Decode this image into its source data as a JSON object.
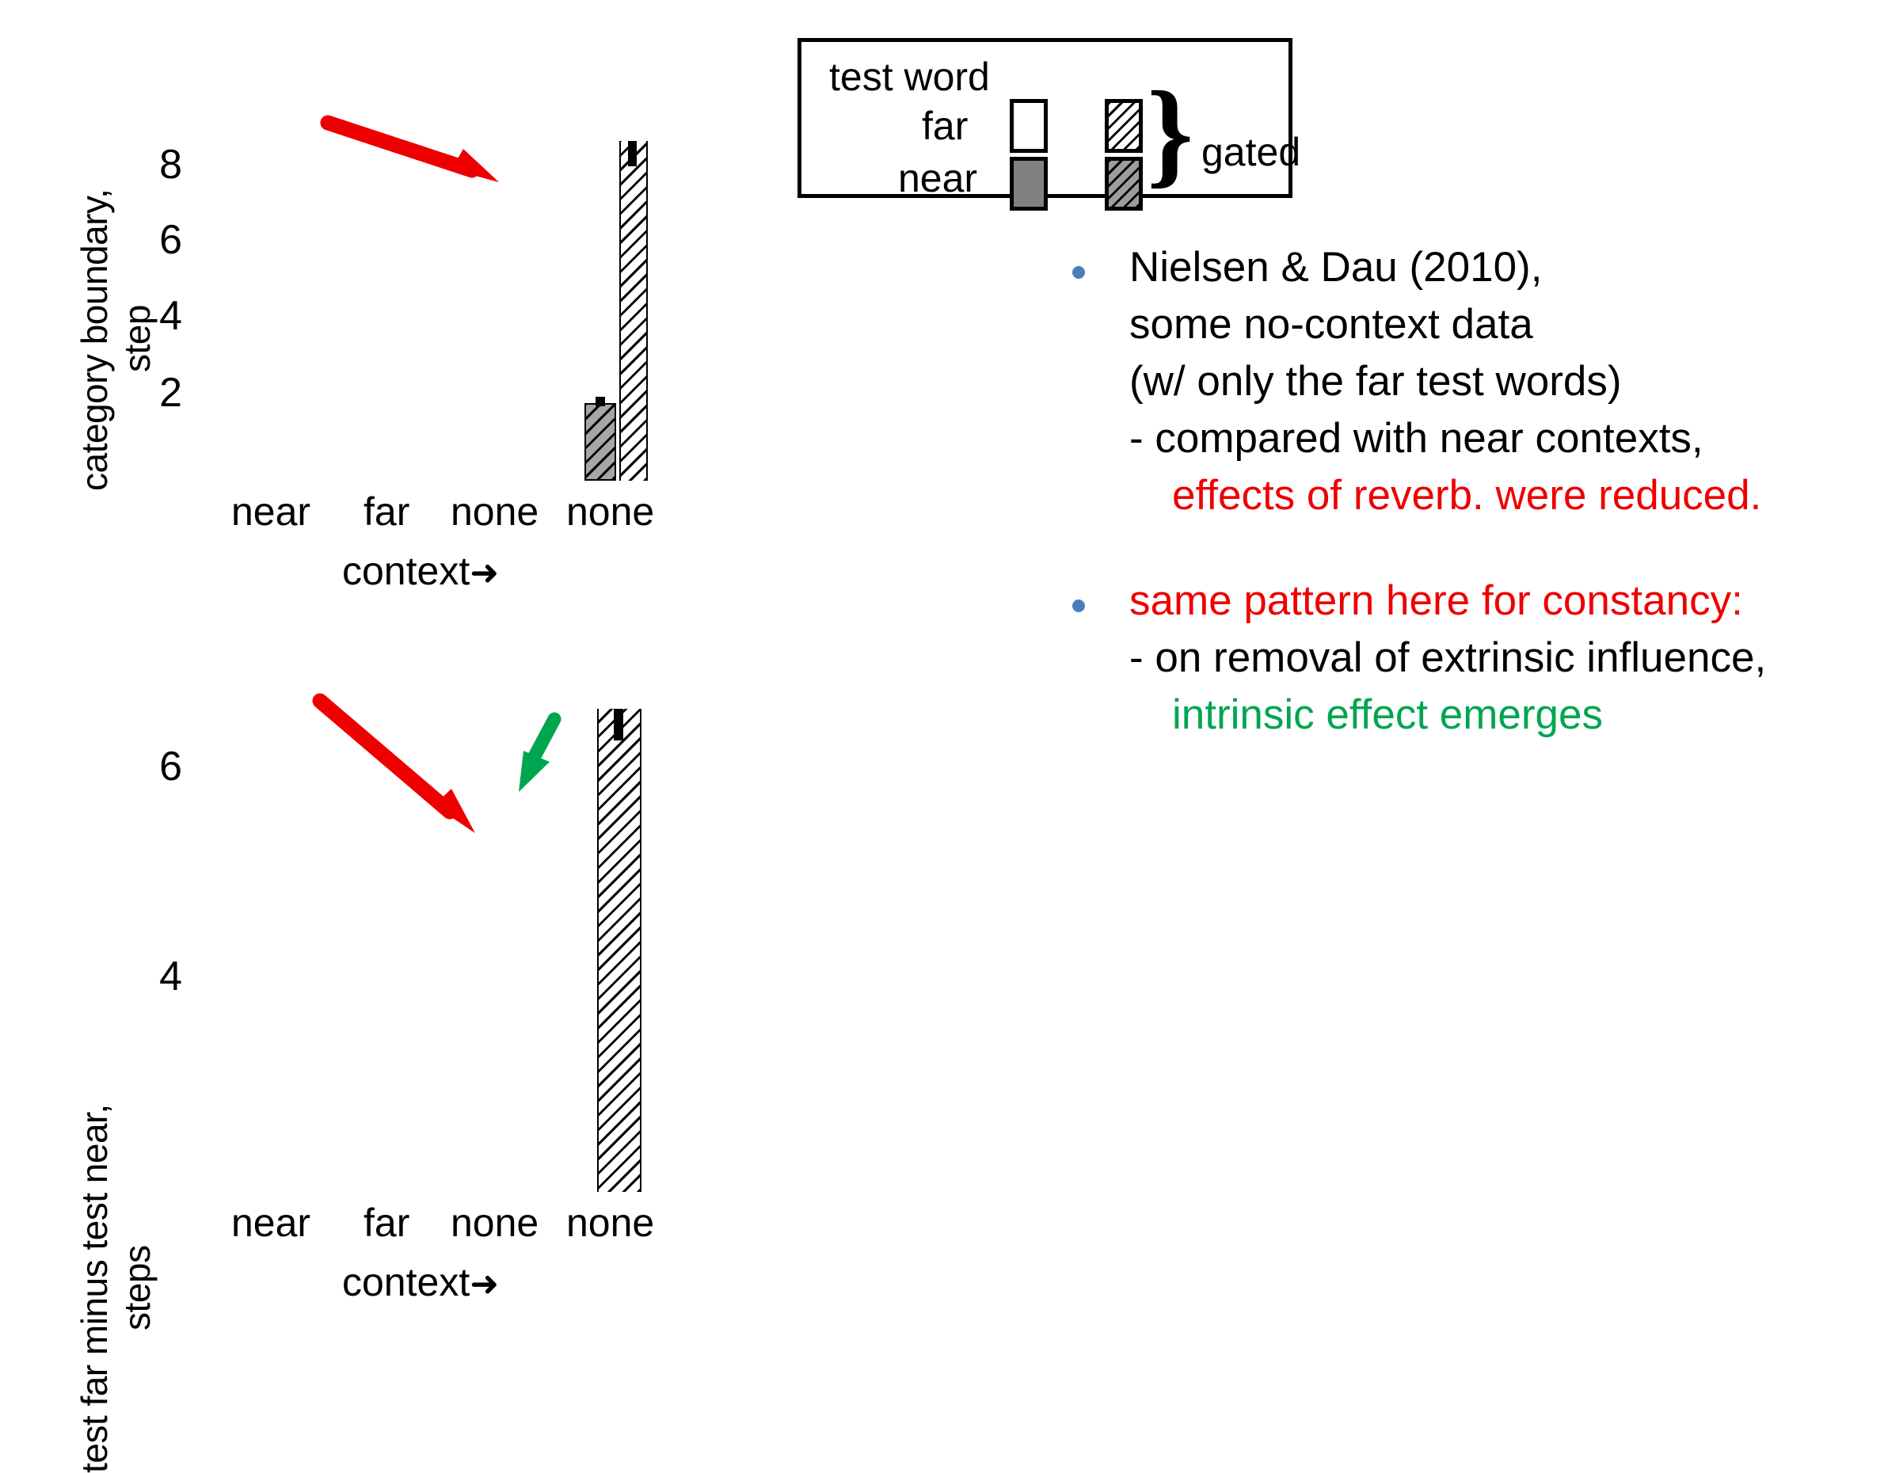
{
  "legend": {
    "title": "test word",
    "row_far_label": "far",
    "row_near_label": "near",
    "gated_label": "gated",
    "brace_glyph": "}",
    "swatches": {
      "far_plain": "white-square-swatch",
      "near_plain": "gray-square-swatch",
      "far_gated": "white-hatched-square-swatch",
      "near_gated": "gray-hatched-square-swatch"
    }
  },
  "colors": {
    "red_arrow": "#ee0000",
    "green_arrow": "#00a550",
    "bullet_dot": "#4a7ebb",
    "red_text": "#ee0000",
    "green_text": "#00a550",
    "gray_bar": "#a6a6a6"
  },
  "chart_data": [
    {
      "id": "upper",
      "type": "bar",
      "title": "",
      "ylabel": "category boundary,\nsteps",
      "ylabel_line1": "category boundary,",
      "ylabel_line2": "step",
      "xlabel": "context",
      "xlabel_arrow": "➜",
      "categories": [
        "near",
        "far",
        "none",
        "none"
      ],
      "yticks": [
        8,
        6,
        4,
        2
      ],
      "ylim": [
        0,
        8.8
      ],
      "grid": false,
      "legend_position": "external-top",
      "series": [
        {
          "name": "near, gated",
          "swatch": "gray-hatched",
          "values": [
            null,
            null,
            2.0,
            null
          ],
          "errors": [
            null,
            null,
            0.12,
            null
          ]
        },
        {
          "name": "far, gated",
          "swatch": "white-hatched",
          "values": [
            null,
            null,
            null,
            8.4
          ],
          "errors": [
            null,
            null,
            null,
            0.25
          ]
        }
      ]
    },
    {
      "id": "lower",
      "type": "bar",
      "title": "",
      "ylabel_line1": "test far minus test near,",
      "ylabel_line2": "steps",
      "xlabel": "context",
      "xlabel_arrow": "➜",
      "categories": [
        "near",
        "far",
        "none",
        "none"
      ],
      "yticks": [
        6,
        4
      ],
      "ylim": [
        2.0,
        6.7
      ],
      "grid": false,
      "series": [
        {
          "name": "far minus near, gated",
          "swatch": "white-hatched",
          "values": [
            null,
            null,
            null,
            6.35
          ],
          "errors": [
            null,
            null,
            null,
            0.2
          ]
        }
      ]
    }
  ],
  "annotations": {
    "red_arrow_upper": "red-arrow-pointing-down-right",
    "red_arrow_lower": "red-arrow-pointing-down-right",
    "green_arrow_lower": "green-arrow-pointing-down-left"
  },
  "notes": {
    "bullet1": {
      "lines": [
        {
          "text": "Nielsen & Dau (2010),",
          "color": "black"
        },
        {
          "text": "some no-context data",
          "color": "black"
        },
        {
          "text": "(w/ only the far test words)",
          "color": "black"
        },
        {
          "text": "- compared with near contexts,",
          "color": "black"
        },
        {
          "text": "effects of reverb. were reduced.",
          "color": "red"
        }
      ]
    },
    "bullet2": {
      "lines": [
        {
          "text": "same pattern here for constancy:",
          "color": "red"
        },
        {
          "text": "- on removal of extrinsic influence,",
          "color": "black"
        },
        {
          "text": "intrinsic effect emerges",
          "color": "green"
        }
      ]
    }
  }
}
